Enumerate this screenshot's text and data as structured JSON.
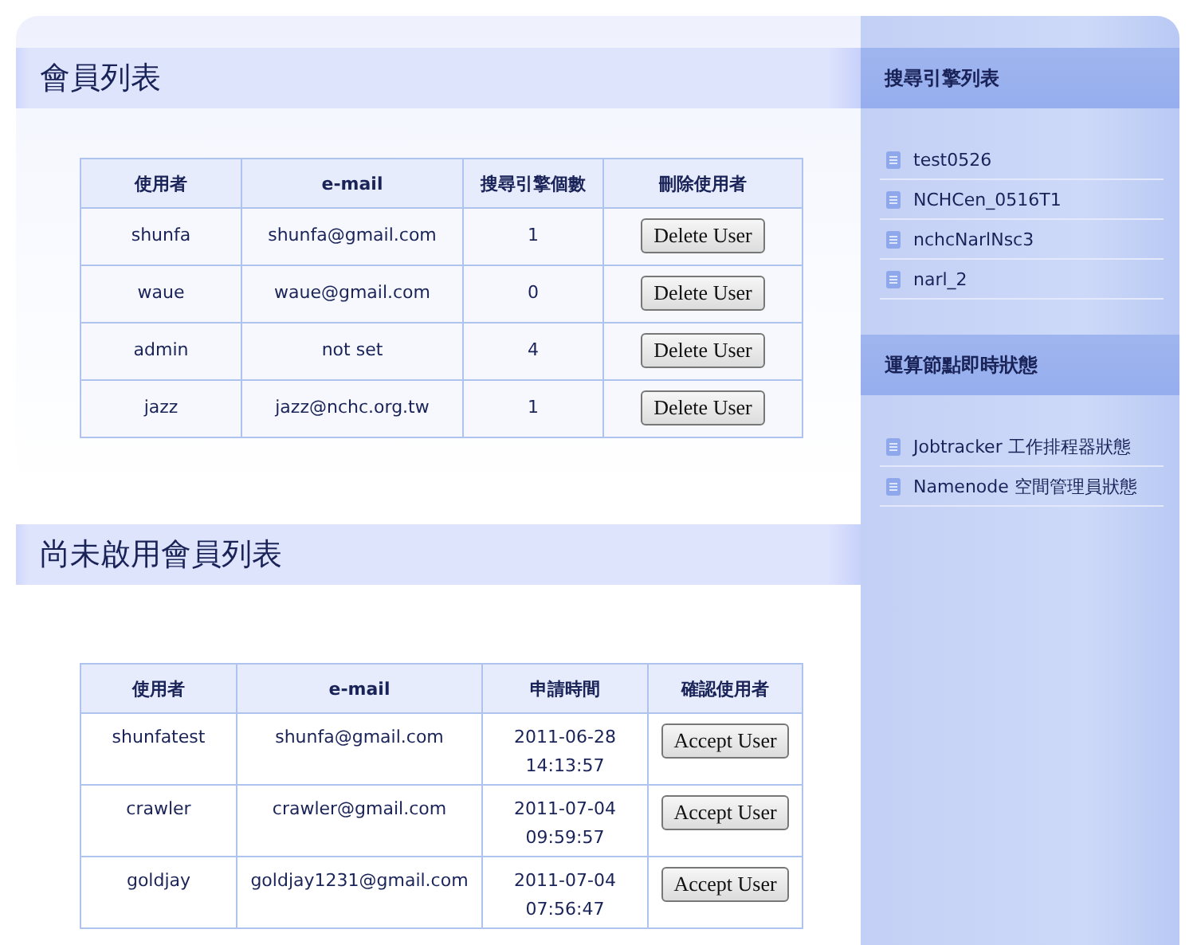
{
  "sections": [
    {
      "title": "會員列表",
      "columns": [
        "使用者",
        "e-mail",
        "搜尋引擎個數",
        "刪除使用者"
      ],
      "rows": [
        {
          "cells": [
            "shunfa",
            "shunfa@gmail.com",
            "1"
          ],
          "button": "Delete User"
        },
        {
          "cells": [
            "waue",
            "waue@gmail.com",
            "0"
          ],
          "button": "Delete User"
        },
        {
          "cells": [
            "admin",
            "not set",
            "4"
          ],
          "button": "Delete User"
        },
        {
          "cells": [
            "jazz",
            "jazz@nchc.org.tw",
            "1"
          ],
          "button": "Delete User"
        }
      ]
    },
    {
      "title": "尚未啟用會員列表",
      "columns": [
        "使用者",
        "e-mail",
        "申請時間",
        "確認使用者"
      ],
      "rows": [
        {
          "cells": [
            "shunfatest",
            "shunfa@gmail.com",
            "2011-06-28 14:13:57"
          ],
          "button": "Accept User"
        },
        {
          "cells": [
            "crawler",
            "crawler@gmail.com",
            "2011-07-04 09:59:57"
          ],
          "button": "Accept User"
        },
        {
          "cells": [
            "goldjay",
            "goldjay1231@gmail.com",
            "2011-07-04 07:56:47"
          ],
          "button": "Accept User"
        }
      ]
    }
  ],
  "sidebar": [
    {
      "title": "搜尋引擎列表",
      "items": [
        "test0526",
        "NCHCen_0516T1",
        "nchcNarlNsc3",
        "narl_2"
      ]
    },
    {
      "title": "運算節點即時狀態",
      "items": [
        "Jobtracker 工作排程器狀態",
        "Namenode 空間管理員狀態"
      ]
    }
  ]
}
